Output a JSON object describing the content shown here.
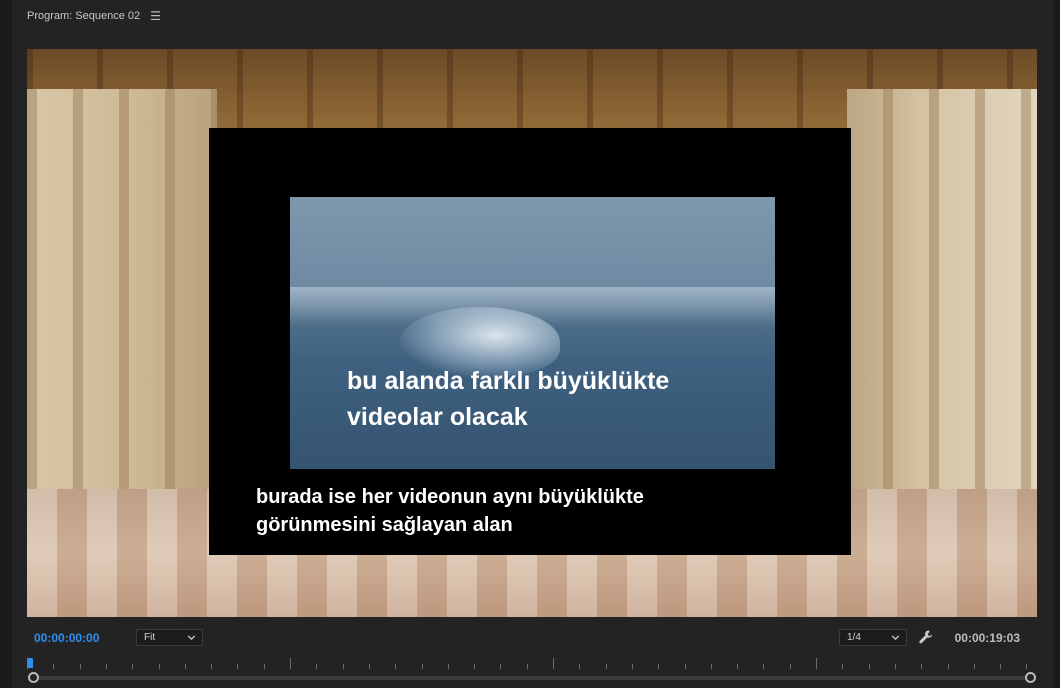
{
  "panel": {
    "title": "Program: Sequence 02",
    "menu_icon": "hamburger-menu-icon"
  },
  "monitor": {
    "video_caption_line1": "bu alanda farklı büyüklükte",
    "video_caption_line2": "videolar olacak",
    "frame_caption_line1": "burada ise her videonun aynı büyüklükte",
    "frame_caption_line2": "görünmesini sağlayan alan"
  },
  "controls": {
    "current_timecode": "00:00:00:00",
    "zoom_value": "Fit",
    "resolution_value": "1/4",
    "duration_timecode": "00:00:19:03",
    "settings_icon": "wrench-icon"
  },
  "colors": {
    "accent": "#2f8ff1",
    "panel_bg": "#232323",
    "caption_text": "#ffffff"
  }
}
